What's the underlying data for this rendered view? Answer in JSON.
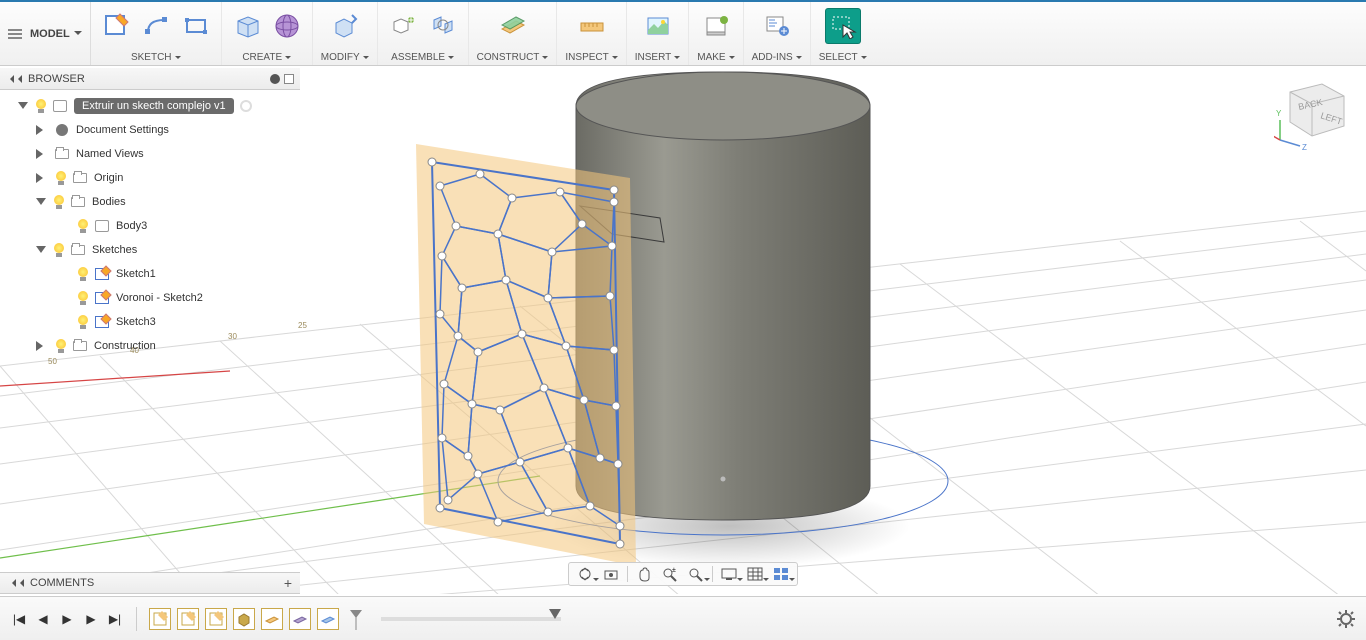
{
  "toolbar": {
    "workspace": "MODEL",
    "groups": [
      {
        "label": "SKETCH"
      },
      {
        "label": "CREATE"
      },
      {
        "label": "MODIFY"
      },
      {
        "label": "ASSEMBLE"
      },
      {
        "label": "CONSTRUCT"
      },
      {
        "label": "INSPECT"
      },
      {
        "label": "INSERT"
      },
      {
        "label": "MAKE"
      },
      {
        "label": "ADD-INS"
      },
      {
        "label": "SELECT"
      }
    ]
  },
  "browser": {
    "title": "BROWSER",
    "root": "Extruir un skecth complejo v1",
    "items": {
      "doc_settings": "Document Settings",
      "named_views": "Named Views",
      "origin": "Origin",
      "bodies": "Bodies",
      "body3": "Body3",
      "sketches": "Sketches",
      "sketch1": "Sketch1",
      "voronoi": "Voronoi - Sketch2",
      "sketch3": "Sketch3",
      "construction": "Construction"
    }
  },
  "comments": {
    "title": "COMMENTS"
  },
  "viewcube": {
    "face1": "BACK",
    "face2": "LEFT"
  }
}
